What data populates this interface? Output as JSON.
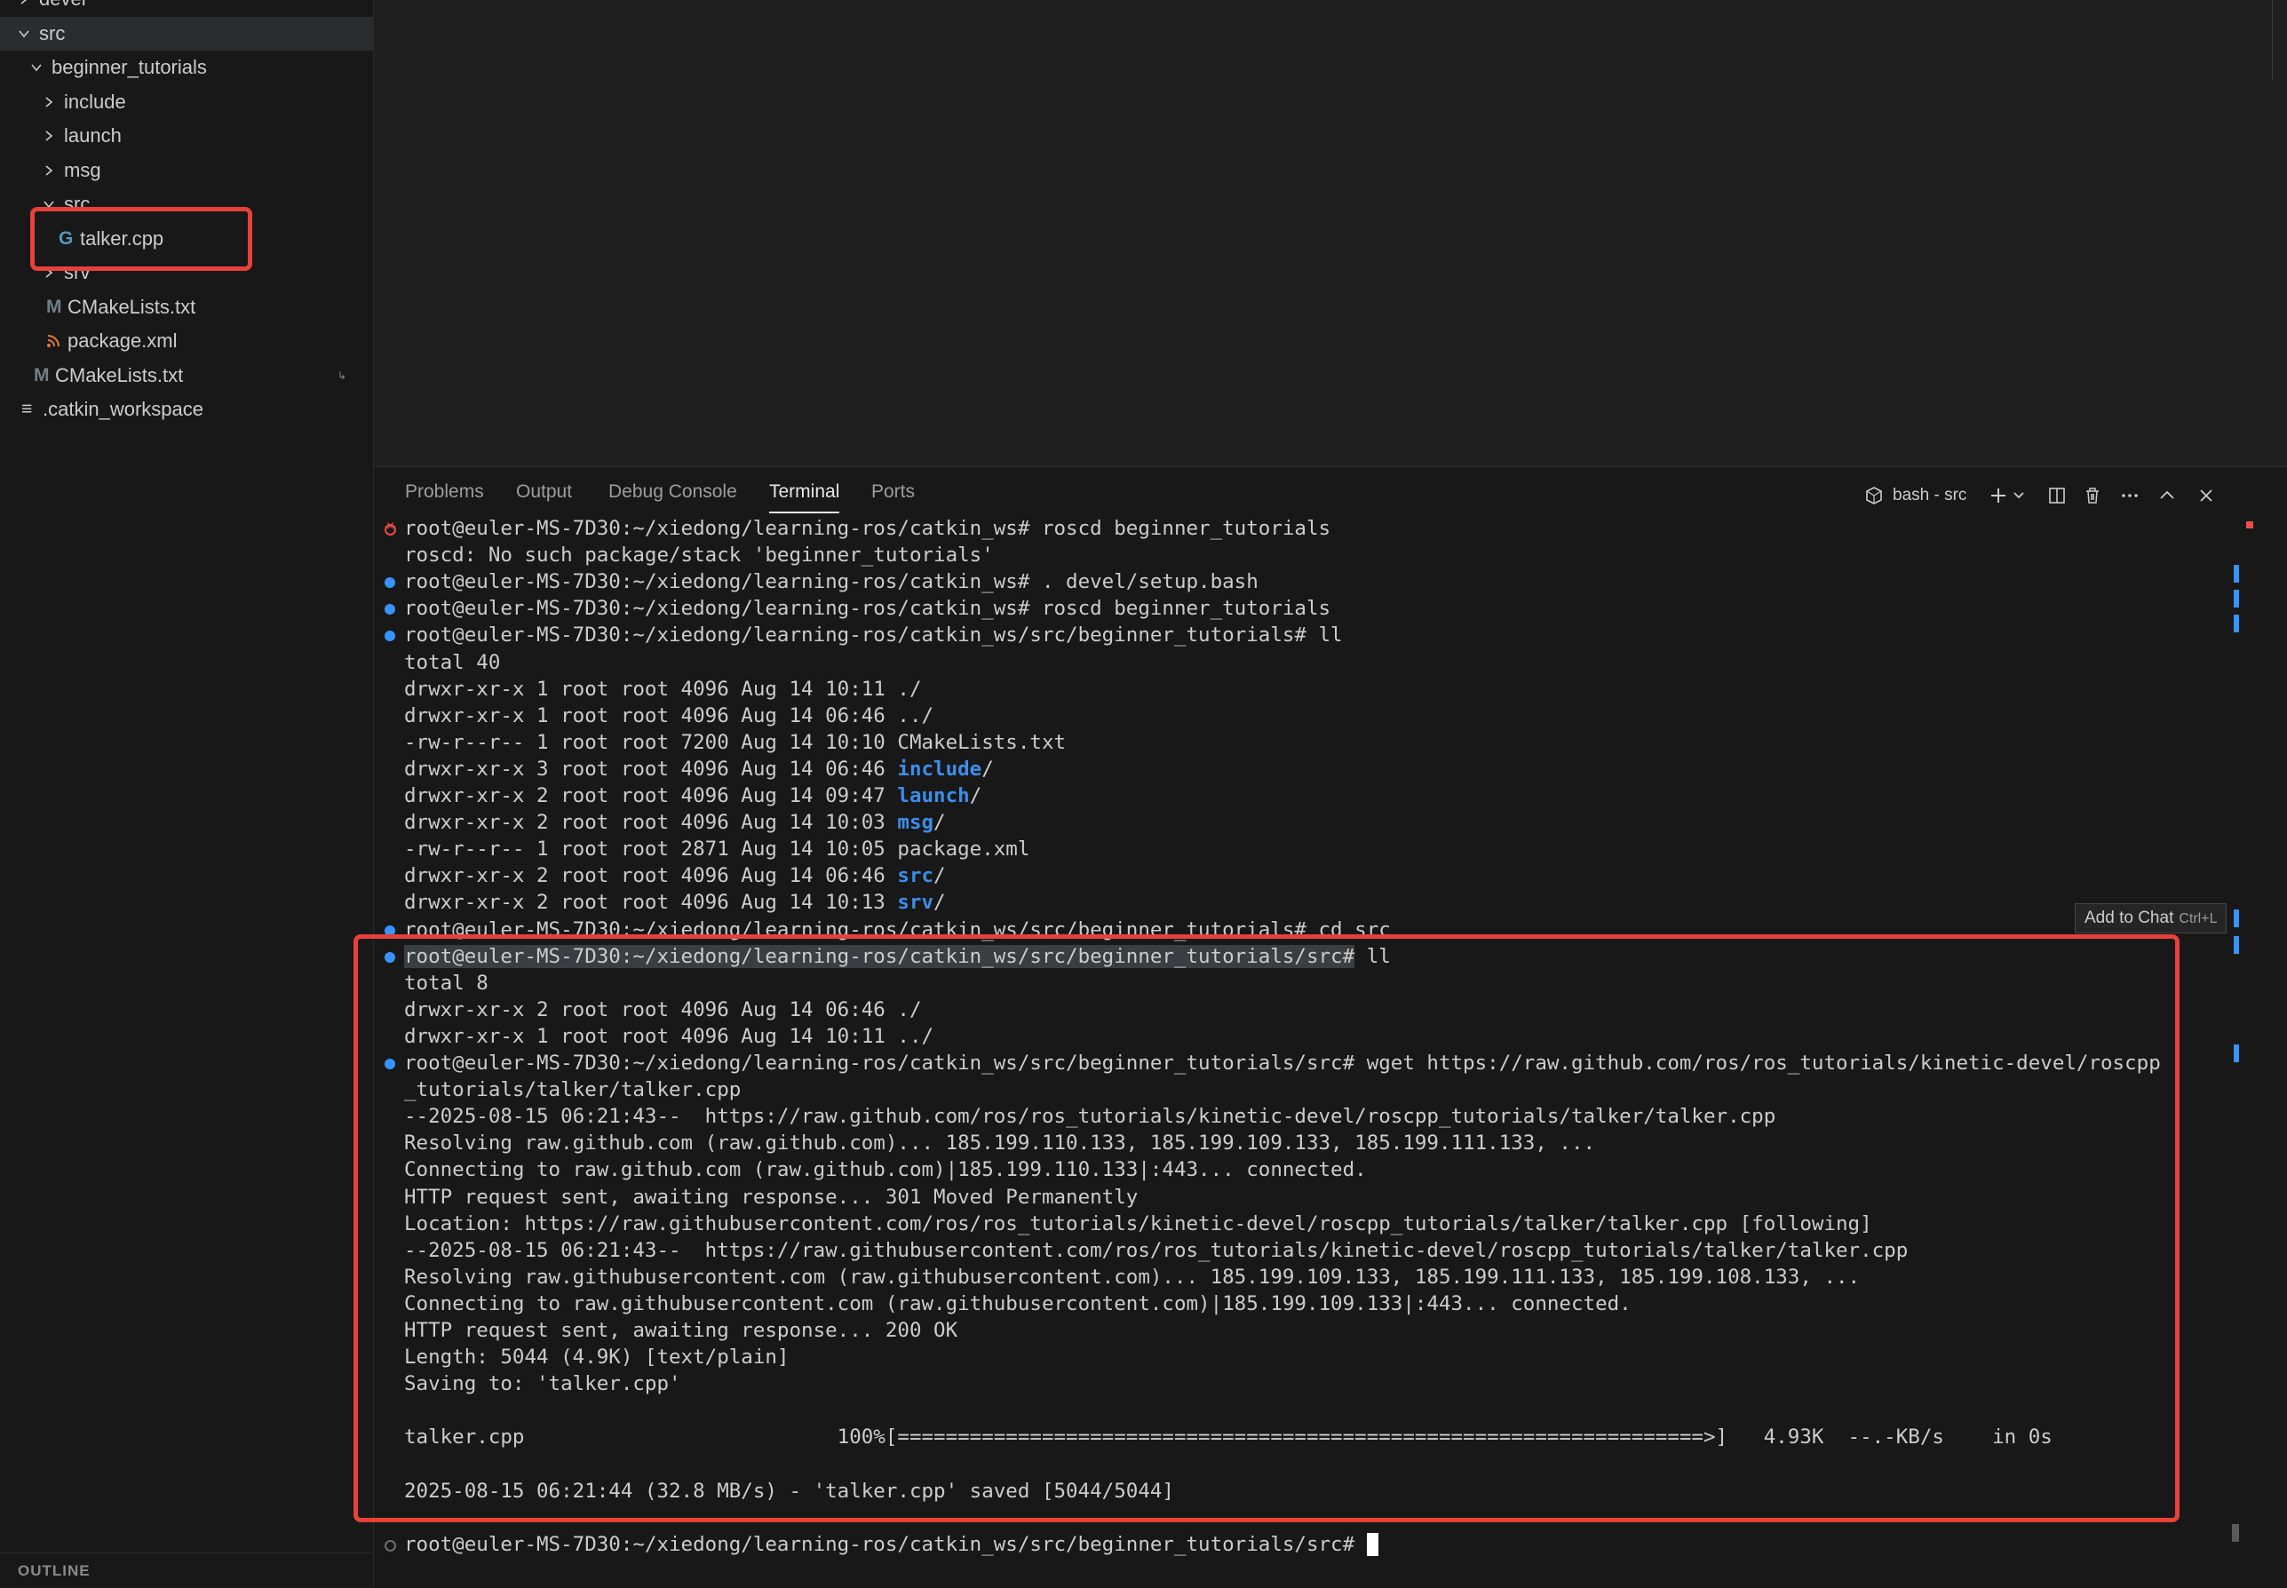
{
  "explorer": {
    "items": [
      {
        "label": "devel",
        "depth": 0,
        "kind": "folder",
        "state": "collapsed"
      },
      {
        "label": "src",
        "depth": 0,
        "kind": "folder",
        "state": "expanded"
      },
      {
        "label": "beginner_tutorials",
        "depth": 1,
        "kind": "folder",
        "state": "expanded"
      },
      {
        "label": "include",
        "depth": 2,
        "kind": "folder",
        "state": "collapsed"
      },
      {
        "label": "launch",
        "depth": 2,
        "kind": "folder",
        "state": "collapsed"
      },
      {
        "label": "msg",
        "depth": 2,
        "kind": "folder",
        "state": "collapsed"
      },
      {
        "label": "src",
        "depth": 2,
        "kind": "folder",
        "state": "expanded"
      },
      {
        "label": "talker.cpp",
        "depth": 3,
        "kind": "cpp-file"
      },
      {
        "label": "srv",
        "depth": 2,
        "kind": "folder",
        "state": "collapsed"
      },
      {
        "label": "CMakeLists.txt",
        "depth": 2,
        "kind": "cmake-file"
      },
      {
        "label": "package.xml",
        "depth": 2,
        "kind": "xml-file"
      },
      {
        "label": "CMakeLists.txt",
        "depth": 1,
        "kind": "cmake-file"
      },
      {
        "label": ".catkin_workspace",
        "depth": 0,
        "kind": "text-file"
      }
    ],
    "icon_glyphs": {
      "cpp": "G",
      "cmake": "M",
      "text": "≡"
    },
    "outline_label": "OUTLINE",
    "colors": {
      "cpp_icon": "#519aba",
      "cmake_icon": "#6d8086",
      "xml_icon": "#e37933"
    }
  },
  "panel": {
    "tabs": [
      "Problems",
      "Output",
      "Debug Console",
      "Terminal",
      "Ports"
    ],
    "active_tab": "Terminal",
    "terminal_name": "bash - src"
  },
  "tooltip": {
    "label": "Add to Chat",
    "shortcut": "Ctrl+L"
  },
  "terminal": {
    "lines": [
      {
        "mark": "err",
        "text": "root@euler-MS-7D30:~/xiedong/learning-ros/catkin_ws# roscd beginner_tutorials"
      },
      {
        "mark": "",
        "text": "roscd: No such package/stack 'beginner_tutorials'"
      },
      {
        "mark": "blue",
        "text": "root@euler-MS-7D30:~/xiedong/learning-ros/catkin_ws# . devel/setup.bash"
      },
      {
        "mark": "blue",
        "text": "root@euler-MS-7D30:~/xiedong/learning-ros/catkin_ws# roscd beginner_tutorials"
      },
      {
        "mark": "blue",
        "text": "root@euler-MS-7D30:~/xiedong/learning-ros/catkin_ws/src/beginner_tutorials# ll"
      },
      {
        "mark": "",
        "text": "total 40"
      },
      {
        "mark": "",
        "text": "drwxr-xr-x 1 root root 4096 Aug 14 10:11 ./"
      },
      {
        "mark": "",
        "text": "drwxr-xr-x 1 root root 4096 Aug 14 06:46 ../"
      },
      {
        "mark": "",
        "text": "-rw-r--r-- 1 root root 7200 Aug 14 10:10 CMakeLists.txt"
      },
      {
        "mark": "",
        "text": "drwxr-xr-x 3 root root 4096 Aug 14 06:46 ",
        "dir": "include",
        "tail": "/"
      },
      {
        "mark": "",
        "text": "drwxr-xr-x 2 root root 4096 Aug 14 09:47 ",
        "dir": "launch",
        "tail": "/"
      },
      {
        "mark": "",
        "text": "drwxr-xr-x 2 root root 4096 Aug 14 10:03 ",
        "dir": "msg",
        "tail": "/"
      },
      {
        "mark": "",
        "text": "-rw-r--r-- 1 root root 2871 Aug 14 10:05 package.xml"
      },
      {
        "mark": "",
        "text": "drwxr-xr-x 2 root root 4096 Aug 14 06:46 ",
        "dir": "src",
        "tail": "/"
      },
      {
        "mark": "",
        "text": "drwxr-xr-x 2 root root 4096 Aug 14 10:13 ",
        "dir": "srv",
        "tail": "/"
      },
      {
        "mark": "blue",
        "text": "root@euler-MS-7D30:~/xiedong/learning-ros/catkin_ws/src/beginner_tutorials# cd src"
      },
      {
        "mark": "blue",
        "sel": "root@euler-MS-7D30:~/xiedong/learning-ros/catkin_ws/src/beginner_tutorials/src#",
        "text": " ll"
      },
      {
        "mark": "",
        "text": "total 8"
      },
      {
        "mark": "",
        "text": "drwxr-xr-x 2 root root 4096 Aug 14 06:46 ./"
      },
      {
        "mark": "",
        "text": "drwxr-xr-x 1 root root 4096 Aug 14 10:11 ../"
      },
      {
        "mark": "blue",
        "text": "root@euler-MS-7D30:~/xiedong/learning-ros/catkin_ws/src/beginner_tutorials/src# wget https://raw.github.com/ros/ros_tutorials/kinetic-devel/roscpp"
      },
      {
        "mark": "",
        "text": "_tutorials/talker/talker.cpp"
      },
      {
        "mark": "",
        "text": "--2025-08-15 06:21:43--  https://raw.github.com/ros/ros_tutorials/kinetic-devel/roscpp_tutorials/talker/talker.cpp"
      },
      {
        "mark": "",
        "text": "Resolving raw.github.com (raw.github.com)... 185.199.110.133, 185.199.109.133, 185.199.111.133, ..."
      },
      {
        "mark": "",
        "text": "Connecting to raw.github.com (raw.github.com)|185.199.110.133|:443... connected."
      },
      {
        "mark": "",
        "text": "HTTP request sent, awaiting response... 301 Moved Permanently"
      },
      {
        "mark": "",
        "text": "Location: https://raw.githubusercontent.com/ros/ros_tutorials/kinetic-devel/roscpp_tutorials/talker/talker.cpp [following]"
      },
      {
        "mark": "",
        "text": "--2025-08-15 06:21:43--  https://raw.githubusercontent.com/ros/ros_tutorials/kinetic-devel/roscpp_tutorials/talker/talker.cpp"
      },
      {
        "mark": "",
        "text": "Resolving raw.githubusercontent.com (raw.githubusercontent.com)... 185.199.109.133, 185.199.111.133, 185.199.108.133, ..."
      },
      {
        "mark": "",
        "text": "Connecting to raw.githubusercontent.com (raw.githubusercontent.com)|185.199.109.133|:443... connected."
      },
      {
        "mark": "",
        "text": "HTTP request sent, awaiting response... 200 OK"
      },
      {
        "mark": "",
        "text": "Length: 5044 (4.9K) [text/plain]"
      },
      {
        "mark": "",
        "text": "Saving to: 'talker.cpp'"
      },
      {
        "mark": "",
        "text": ""
      },
      {
        "mark": "",
        "text": "talker.cpp                          100%[===================================================================>]   4.93K  --.-KB/s    in 0s"
      },
      {
        "mark": "",
        "text": ""
      },
      {
        "mark": "",
        "text": "2025-08-15 06:21:44 (32.8 MB/s) - 'talker.cpp' saved [5044/5044]"
      },
      {
        "mark": "",
        "text": ""
      },
      {
        "mark": "empty",
        "text": "root@euler-MS-7D30:~/xiedong/learning-ros/catkin_ws/src/beginner_tutorials/src# ",
        "cursor": true
      }
    ]
  }
}
